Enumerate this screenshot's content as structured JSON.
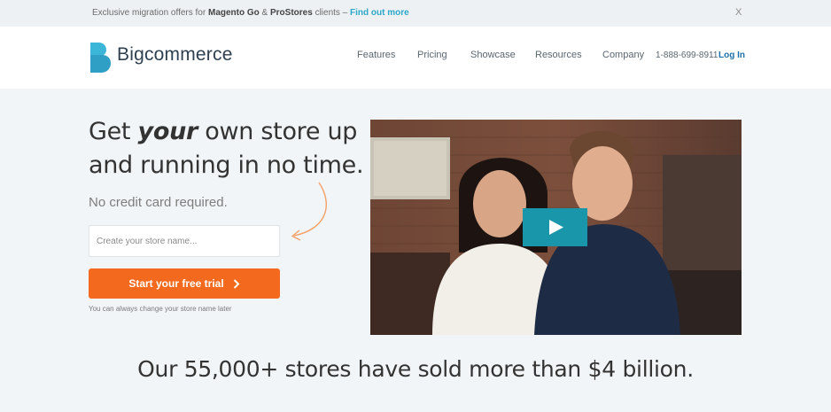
{
  "announcement": {
    "prefix": "Exclusive migration offers for ",
    "brand1": "Magento Go",
    "amp": " & ",
    "brand2": "ProStores",
    "suffix": " clients – ",
    "link": "Find out more",
    "close": "X"
  },
  "header": {
    "brand": "Bigcommerce",
    "nav": [
      "Features",
      "Pricing",
      "Showcase",
      "Resources",
      "Company"
    ],
    "phone": "1-888-699-8911",
    "login": "Log In"
  },
  "hero": {
    "title_pre": "Get ",
    "title_em": "your",
    "title_post": " own store up",
    "title_line2": "and running in no time.",
    "subtitle": "No credit card required.",
    "input_placeholder": "Create your store name...",
    "cta": "Start your free trial",
    "hint": "You can always change your store name later"
  },
  "stats": {
    "pre": "Our ",
    "stores": "55,000+",
    "mid": " stores have sold more than ",
    "amount": "$4 billion",
    "end": "."
  },
  "colors": {
    "accent": "#f36a1f",
    "brand": "#2f4151",
    "link": "#2ba7c9",
    "logo": "#3cb6d8"
  },
  "icons": {
    "logo": "bigcommerce-logo-icon",
    "close": "close-icon",
    "cta": "chevron-right-icon",
    "play": "play-icon",
    "arrow": "curved-arrow-icon"
  }
}
